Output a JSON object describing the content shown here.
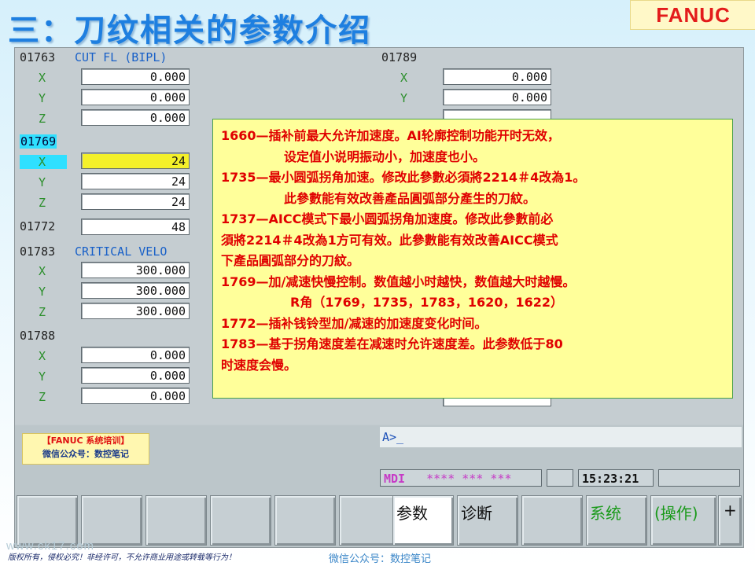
{
  "title": "三：刀纹相关的参数介绍",
  "logo": "FANUC",
  "params_left": [
    {
      "num": "01763",
      "name": "CUT FL (BIPL)",
      "rows": [
        [
          "X",
          "0.000"
        ],
        [
          "Y",
          "0.000"
        ],
        [
          "Z",
          "0.000"
        ]
      ]
    },
    {
      "num": "01769",
      "name": "",
      "rows": [
        [
          "X",
          "24"
        ],
        [
          "Y",
          "24"
        ],
        [
          "Z",
          "24"
        ]
      ]
    },
    {
      "num": "01772",
      "name": "",
      "value": "48"
    },
    {
      "num": "01783",
      "name": "CRITICAL VELO",
      "rows": [
        [
          "X",
          "300.000"
        ],
        [
          "Y",
          "300.000"
        ],
        [
          "Z",
          "300.000"
        ]
      ]
    },
    {
      "num": "01788",
      "name": "",
      "rows": [
        [
          "X",
          "0.000"
        ],
        [
          "Y",
          "0.000"
        ],
        [
          "Z",
          "0.000"
        ]
      ]
    }
  ],
  "params_right": [
    {
      "num": "01789",
      "rows": [
        [
          "X",
          "0.000"
        ],
        [
          "Y",
          "0.000"
        ]
      ]
    }
  ],
  "note_lines": [
    "1660—插补前最大允许加速度。AI轮廓控制功能开时无效，",
    "设定值小说明振动小，加速度也小。",
    "1735—最小圆弧拐角加速。修改此參數必須將2214＃4改為1。",
    "此參數能有效改善產品圓弧部分產生的刀紋。",
    "1737—AICC模式下最小圆弧拐角加速度。修改此參數前必",
    "須將2214＃4改為1方可有效。此參數能有效改善AICC模式",
    "下產品圓弧部分的刀紋。",
    "1769—加/减速快慢控制。数值越小时越快，数值越大时越慢。",
    "R角（1769，1735，1783，1620，1622）",
    "1772—插补钱铃型加/减速的加速度变化时间。",
    "1783—基于拐角速度差在减速时允许速度差。此参数低于80",
    "时速度会慢。"
  ],
  "input_prompt": "A>_",
  "status": {
    "mode": "MDI",
    "flags": "**** *** ***",
    "time": "15:23:21"
  },
  "softkeys": [
    "参数",
    "诊断",
    "",
    "系统",
    "(操作)",
    "+"
  ],
  "training": {
    "line1": "【FANUC 系统培训】",
    "line2": "微信公众号：数控笔记"
  },
  "footer_left": "版权所有，侵权必究！非经许可，不允许商业用途或转载等行为！",
  "footer_right": "微信公众号：数控笔记",
  "watermark": "www.ck17.com"
}
